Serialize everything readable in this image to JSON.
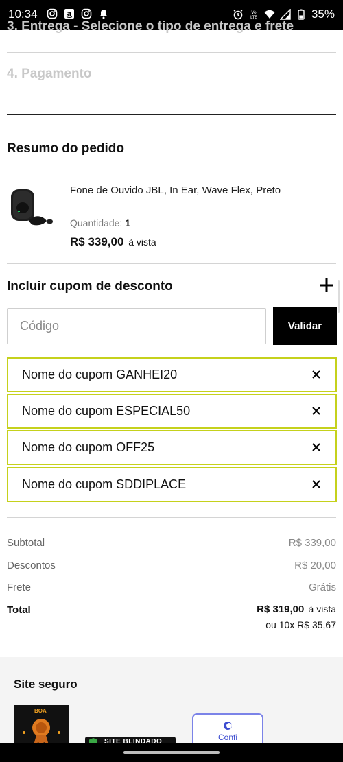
{
  "status_bar": {
    "time": "10:34",
    "battery": "35%",
    "icons_left": [
      "instagram-icon",
      "amazon-icon",
      "instagram-icon",
      "notification-bell-icon"
    ],
    "icons_right": [
      "alarm-icon",
      "volte-icon",
      "wifi-icon",
      "signal-icon",
      "battery-icon"
    ]
  },
  "checkout": {
    "cut_step_text": "3. Entrega - Selecione o tipo de entrega e frete",
    "payment_step": "4. Pagamento"
  },
  "summary": {
    "title": "Resumo do pedido",
    "product": {
      "name": "Fone de Ouvido JBL, In Ear, Wave Flex, Preto",
      "quantity_label": "Quantidade:",
      "quantity": "1",
      "price": "R$ 339,00",
      "price_suffix": "à vista"
    }
  },
  "coupon": {
    "title": "Incluir cupom de desconto",
    "input_placeholder": "Código",
    "validate_label": "Validar",
    "applied": [
      {
        "label": "Nome do cupom GANHEI20"
      },
      {
        "label": "Nome do cupom ESPECIAL50"
      },
      {
        "label": "Nome do cupom OFF25"
      },
      {
        "label": "Nome do cupom SDDIPLACE"
      }
    ],
    "accent_color": "#c5d11c"
  },
  "totals": {
    "subtotal_label": "Subtotal",
    "subtotal_value": "R$ 339,00",
    "discounts_label": "Descontos",
    "discounts_value": "R$ 20,00",
    "shipping_label": "Frete",
    "shipping_value": "Grátis",
    "total_label": "Total",
    "total_value": "R$ 319,00",
    "total_suffix": "à vista",
    "installments": "ou 10x R$ 35,67"
  },
  "secure_site": {
    "title": "Site seguro",
    "badge_boa_text": "BOA",
    "badge_blindado_text": "SITE BLINDADO",
    "badge_confi_text": "Confi"
  }
}
